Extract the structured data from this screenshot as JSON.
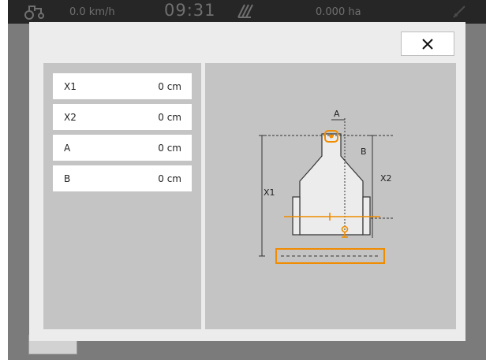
{
  "statusbar": {
    "speed": "0.0 km/h",
    "time": "09:31",
    "area": "0.000 ha"
  },
  "icons": {
    "tractor": "tractor-icon",
    "field": "field-icon",
    "signal": "signal-icon",
    "close": "close-icon"
  },
  "dialog": {
    "close_label": "×"
  },
  "dimensions": [
    {
      "label": "X1",
      "value": "0 cm"
    },
    {
      "label": "X2",
      "value": "0 cm"
    },
    {
      "label": "A",
      "value": "0 cm"
    },
    {
      "label": "B",
      "value": "0 cm"
    }
  ],
  "diagram": {
    "label_a": "A",
    "label_b": "B",
    "label_x1": "X1",
    "label_x2": "X2"
  },
  "colors": {
    "accent": "#f08c00",
    "panel": "#c4c4c4",
    "dialog": "#ececec"
  }
}
